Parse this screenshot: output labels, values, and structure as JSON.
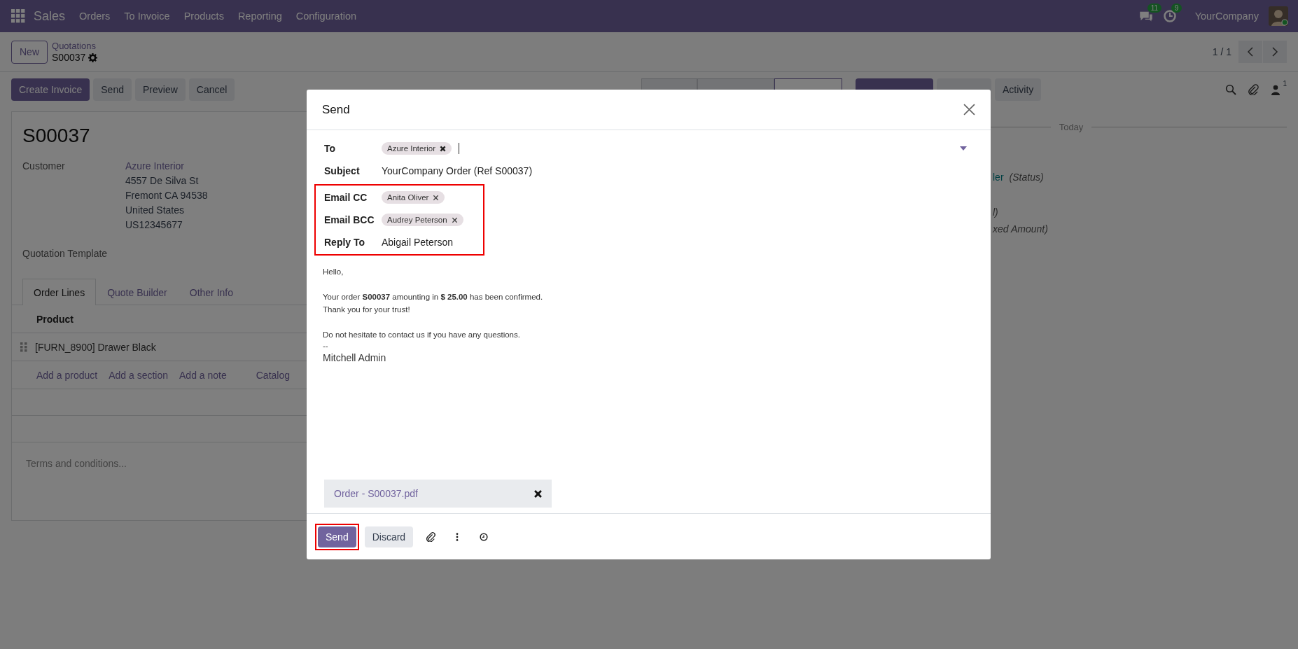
{
  "navbar": {
    "app": "Sales",
    "menu": [
      "Orders",
      "To Invoice",
      "Products",
      "Reporting",
      "Configuration"
    ],
    "messages_badge": "11",
    "activities_badge": "9",
    "company": "YourCompany"
  },
  "control_panel": {
    "new_button": "New",
    "breadcrumb": "Quotations",
    "record": "S00037",
    "pager": "1 / 1"
  },
  "actions": [
    {
      "label": "Create Invoice",
      "kind": "primary"
    },
    {
      "label": "Send",
      "kind": "secondary"
    },
    {
      "label": "Preview",
      "kind": "secondary"
    },
    {
      "label": "Cancel",
      "kind": "secondary"
    }
  ],
  "statusbar": [
    {
      "selected": false
    },
    {
      "selected": false
    },
    {
      "selected": true
    }
  ],
  "form": {
    "title": "S00037",
    "customer": {
      "label": "Customer",
      "name": "Azure Interior",
      "address": [
        "4557 De Silva St",
        "Fremont CA 94538",
        "United States",
        "US12345677"
      ]
    },
    "template_label": "Quotation Template",
    "tabs": [
      {
        "label": "Order Lines",
        "selected": true
      },
      {
        "label": "Quote Builder",
        "selected": false
      },
      {
        "label": "Other Info",
        "selected": false
      }
    ],
    "table": {
      "columns": [
        "Product"
      ],
      "rows": [
        {
          "product": "[FURN_8900] Drawer Black"
        }
      ],
      "add_links": [
        "Add a product",
        "Add a section",
        "Add a note",
        "Catalog"
      ]
    },
    "terms_placeholder": "Terms and conditions..."
  },
  "chatter": {
    "buttons": [
      {
        "kind": "primary"
      },
      {
        "kind": "secondary"
      },
      {
        "label": "Activity",
        "kind": "secondary"
      }
    ],
    "followers": "1",
    "date_separator": "Today",
    "tracking": [
      {
        "parts": [
          {
            "text": "ler",
            "kind": "link"
          },
          {
            "text": "(Status)",
            "kind": "note"
          }
        ]
      },
      {
        "parts": [
          {
            "text": "l)",
            "kind": "note"
          }
        ]
      },
      {
        "parts": [
          {
            "text": "xed Amount)",
            "kind": "note"
          }
        ]
      }
    ]
  },
  "dialog": {
    "title": "Send",
    "fields": [
      {
        "label": "To",
        "kind": "tags",
        "tags": [
          {
            "label": "Azure Interior",
            "kind": "bold"
          }
        ],
        "highlighted": false
      },
      {
        "label": "Subject",
        "kind": "text",
        "value": "YourCompany Order (Ref S00037)",
        "highlighted": false
      },
      {
        "label": "Email CC",
        "kind": "tags",
        "tags": [
          {
            "label": "Anita Oliver",
            "kind": "light"
          }
        ],
        "highlighted": true
      },
      {
        "label": "Email BCC",
        "kind": "tags",
        "tags": [
          {
            "label": "Audrey Peterson",
            "kind": "light"
          }
        ],
        "highlighted": true
      },
      {
        "label": "Reply To",
        "kind": "text",
        "value": "Abigail Peterson",
        "highlighted": true
      }
    ],
    "body": [
      [
        "Hello,"
      ],
      [
        "Your order **S00037** amounting in **$ 25.00** has been confirmed.",
        "Thank you for your trust!"
      ],
      [
        "Do not hesitate to contact us if you have any questions."
      ]
    ],
    "signature_separator": "--",
    "signature": "Mitchell Admin",
    "attachment": "Order - S00037.pdf",
    "footer": [
      {
        "label": "Send",
        "kind": "primary",
        "highlighted": true
      },
      {
        "label": "Discard",
        "kind": "secondary",
        "highlighted": false
      }
    ]
  }
}
